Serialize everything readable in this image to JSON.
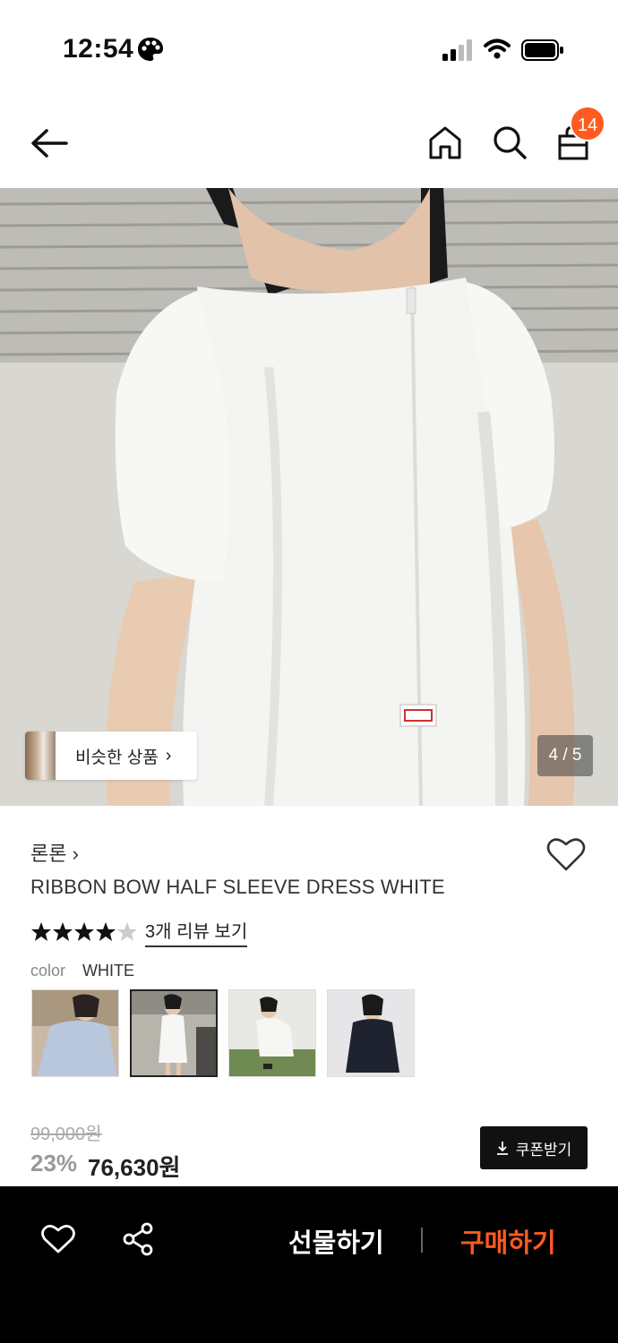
{
  "status_bar": {
    "time": "12:54"
  },
  "header": {
    "cart_count": "14",
    "icons": [
      "back-arrow-icon",
      "home-icon",
      "search-icon",
      "shopping-bag-icon"
    ]
  },
  "gallery": {
    "similar_label": "비슷한 상품",
    "similar_chevron": "›",
    "page_indicator": "4 / 5"
  },
  "product": {
    "brand": "론론 ›",
    "name": "RIBBON BOW HALF SLEEVE DRESS WHITE",
    "rating": 4,
    "review_link": "3개 리뷰 보기",
    "color_label": "color",
    "color_value": "WHITE",
    "swatch_selected_index": 1
  },
  "price": {
    "original": "99,000원",
    "discount": "23%",
    "sale": "76,630원",
    "coupon_label": "쿠폰받기"
  },
  "bottom_bar": {
    "gift_label": "선물하기",
    "buy_label": "구매하기"
  },
  "colors": {
    "accent": "#ff5a1f",
    "bottom_bar": "#000000"
  }
}
